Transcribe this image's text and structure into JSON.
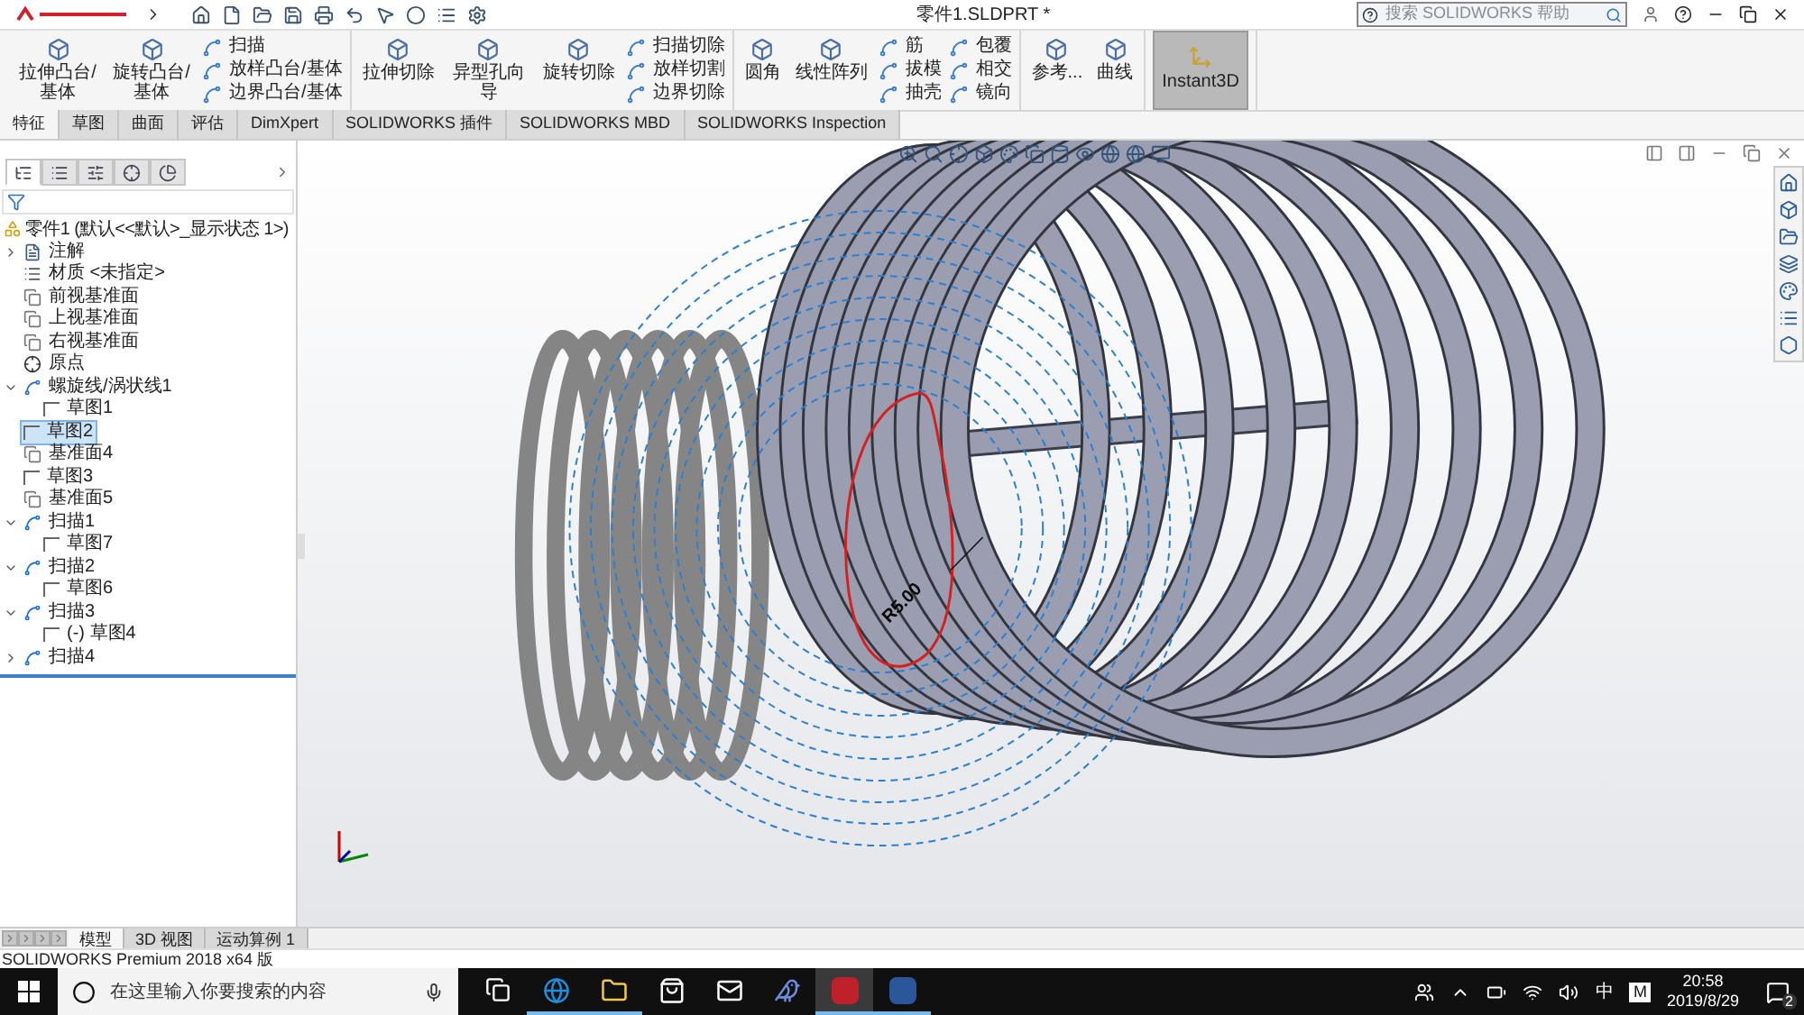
{
  "window": {
    "title": "零件1.SLDPRT *",
    "search": {
      "placeholder": "搜索 SOLIDWORKS 帮助"
    }
  },
  "ribbon": [
    {
      "items": [
        {
          "kind": "large",
          "label": "拉伸凸台/基体"
        },
        {
          "kind": "large",
          "label": "旋转凸台/基体"
        },
        {
          "kind": "stack",
          "entries": [
            "扫描",
            "放样凸台/基体",
            "边界凸台/基体"
          ]
        }
      ]
    },
    {
      "items": [
        {
          "kind": "large",
          "label": "拉伸切除"
        },
        {
          "kind": "large",
          "label": "异型孔向导"
        },
        {
          "kind": "large",
          "label": "旋转切除"
        },
        {
          "kind": "stack",
          "entries": [
            "扫描切除",
            "放样切割",
            "边界切除"
          ]
        }
      ]
    },
    {
      "items": [
        {
          "kind": "large",
          "label": "圆角"
        },
        {
          "kind": "large",
          "label": "线性阵列"
        },
        {
          "kind": "stack",
          "entries": [
            "筋",
            "拔模",
            "抽壳"
          ]
        },
        {
          "kind": "stack",
          "entries": [
            "包覆",
            "相交",
            "镜向"
          ]
        }
      ]
    },
    {
      "items": [
        {
          "kind": "large",
          "label": "参考..."
        },
        {
          "kind": "large",
          "label": "曲线"
        }
      ]
    },
    {
      "items": [
        {
          "kind": "toggle",
          "label": "Instant3D",
          "on": true
        }
      ]
    }
  ],
  "tabs": [
    {
      "label": "特征",
      "selected": true
    },
    {
      "label": "草图",
      "selected": false
    },
    {
      "label": "曲面",
      "selected": false
    },
    {
      "label": "评估",
      "selected": false
    },
    {
      "label": "DimXpert",
      "selected": false
    },
    {
      "label": "SOLIDWORKS 插件",
      "selected": false
    },
    {
      "label": "SOLIDWORKS MBD",
      "selected": false
    },
    {
      "label": "SOLIDWORKS Inspection",
      "selected": false
    }
  ],
  "panel_tabs": [
    {
      "kind": "tree",
      "selected": true
    },
    {
      "kind": "property",
      "selected": false
    },
    {
      "kind": "config",
      "selected": false
    },
    {
      "kind": "dimxpert",
      "selected": false
    },
    {
      "kind": "display",
      "selected": false
    }
  ],
  "tree": {
    "label": "零件1  (默认<<默认>_显示状态 1>)",
    "kind": "part",
    "children": [
      {
        "label": "注解",
        "kind": "annotation",
        "expanded": false,
        "selected": false
      },
      {
        "label": "材质 <未指定>",
        "kind": "material",
        "selected": false
      },
      {
        "label": "前视基准面",
        "kind": "plane",
        "selected": false
      },
      {
        "label": "上视基准面",
        "kind": "plane",
        "selected": false
      },
      {
        "label": "右视基准面",
        "kind": "plane",
        "selected": false
      },
      {
        "label": "原点",
        "kind": "origin",
        "selected": false
      },
      {
        "label": "螺旋线/涡状线1",
        "kind": "helix",
        "expanded": true,
        "selected": false,
        "children": [
          {
            "label": "草图1",
            "kind": "sketch",
            "selected": false
          }
        ]
      },
      {
        "label": "草图2",
        "kind": "sketch",
        "selected": true
      },
      {
        "label": "基准面4",
        "kind": "plane",
        "selected": false
      },
      {
        "label": "草图3",
        "kind": "sketch",
        "selected": false
      },
      {
        "label": "基准面5",
        "kind": "plane",
        "selected": false
      },
      {
        "label": "扫描1",
        "kind": "sweep",
        "expanded": true,
        "selected": false,
        "children": [
          {
            "label": "草图7",
            "kind": "sketch",
            "selected": false
          }
        ]
      },
      {
        "label": "扫描2",
        "kind": "sweep",
        "expanded": true,
        "selected": false,
        "children": [
          {
            "label": "草图6",
            "kind": "sketch",
            "selected": false
          }
        ]
      },
      {
        "label": "扫描3",
        "kind": "sweep",
        "expanded": true,
        "selected": false,
        "children": [
          {
            "label": "(-) 草图4",
            "kind": "sketch",
            "selected": false
          }
        ]
      },
      {
        "label": "扫描4",
        "kind": "sweep",
        "expanded": false,
        "selected": false
      }
    ]
  },
  "viewport": {
    "dimension": "R5.00"
  },
  "bottom_tabs": [
    {
      "label": "模型",
      "selected": true
    },
    {
      "label": "3D 视图",
      "selected": false
    },
    {
      "label": "运动算例 1",
      "selected": false
    }
  ],
  "status_bar": {
    "text": "SOLIDWORKS Premium 2018 x64 版"
  },
  "taskbar": {
    "search": {
      "placeholder": "在这里输入你要搜索的内容"
    },
    "apps": [
      {
        "kind": "taskview",
        "running": false,
        "selected": false
      },
      {
        "kind": "browser",
        "running": true,
        "selected": false
      },
      {
        "kind": "folder",
        "running": true,
        "selected": false
      },
      {
        "kind": "store",
        "running": false,
        "selected": false
      },
      {
        "kind": "mail",
        "running": false,
        "selected": false
      },
      {
        "kind": "bird",
        "running": false,
        "selected": false
      },
      {
        "kind": "cad",
        "running": true,
        "selected": true
      },
      {
        "kind": "word",
        "running": true,
        "selected": false
      }
    ],
    "ime": "中",
    "ime_mode": "M",
    "time": "20:58",
    "date": "2019/8/29",
    "notifications": "2"
  }
}
